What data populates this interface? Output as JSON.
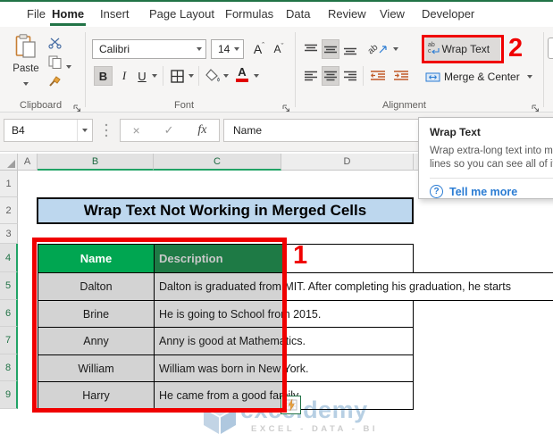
{
  "tabs": {
    "items": [
      {
        "label": "File"
      },
      {
        "label": "Home"
      },
      {
        "label": "Insert"
      },
      {
        "label": "Page Layout"
      },
      {
        "label": "Formulas"
      },
      {
        "label": "Data"
      },
      {
        "label": "Review"
      },
      {
        "label": "View"
      },
      {
        "label": "Developer"
      }
    ]
  },
  "ribbon": {
    "clipboard": {
      "label": "Clipboard",
      "paste": "Paste"
    },
    "font": {
      "label": "Font",
      "font_name": "Calibri",
      "font_size": "14",
      "bold": "B",
      "italic": "I",
      "underline": "U",
      "grow": "A",
      "shrink": "A",
      "font_color": "A"
    },
    "alignment": {
      "label": "Alignment",
      "wrap_text": "Wrap Text",
      "merge_center": "Merge & Center",
      "wrap_icon_ab": "ab",
      "wrap_icon_c": "c",
      "orient_ab": "ab"
    },
    "annotation_2": "2"
  },
  "formula_bar": {
    "name_box": "B4",
    "cancel": "×",
    "enter": "✓",
    "fx": "fx",
    "value": "Name"
  },
  "tooltip": {
    "title": "Wrap Text",
    "line1": "Wrap extra-long text into multiple",
    "line2": "lines so you can see all of it.",
    "q": "?",
    "link": "Tell me more"
  },
  "sheet": {
    "columns": [
      "A",
      "B",
      "C",
      "D"
    ],
    "rows": [
      "1",
      "2",
      "3",
      "4",
      "5",
      "6",
      "7",
      "8",
      "9"
    ],
    "title": "Wrap Text Not Working in Merged Cells",
    "table": {
      "headers": {
        "name": "Name",
        "description": "Description"
      },
      "rows": [
        {
          "name": "Dalton",
          "description": "Dalton is graduated from MIT. After completing his graduation, he starts"
        },
        {
          "name": "Brine",
          "description": "He is going to School from 2015."
        },
        {
          "name": "Anny",
          "description": "Anny is good at Mathematics."
        },
        {
          "name": "William",
          "description": "William was born in New York."
        },
        {
          "name": "Harry",
          "description": "He came from a good family."
        }
      ]
    },
    "annotation_1": "1"
  },
  "watermark": {
    "brand": "exceldemy",
    "tagline": "EXCEL - DATA - BI"
  },
  "colors": {
    "accent_green": "#217346",
    "header_green": "#00A651",
    "header_green_dim": "#1E7A45",
    "selection_gray": "#D3D3D3",
    "title_blue": "#BDD7EE",
    "annotation_red": "#F00000",
    "link_blue": "#2B7CD3"
  }
}
